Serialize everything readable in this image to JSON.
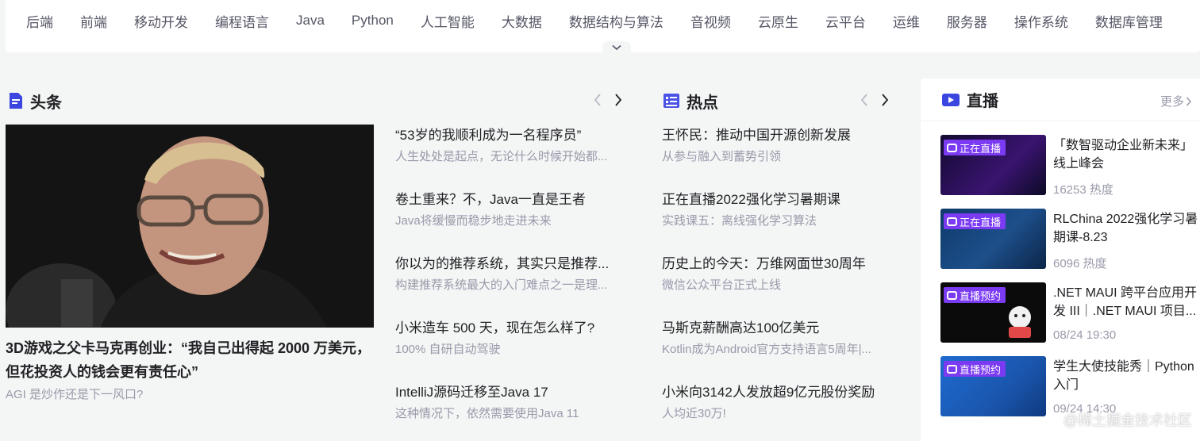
{
  "nav": {
    "categories": [
      "后端",
      "前端",
      "移动开发",
      "编程语言",
      "Java",
      "Python",
      "人工智能",
      "大数据",
      "数据结构与算法",
      "音视频",
      "云原生",
      "云平台",
      "运维",
      "服务器",
      "操作系统",
      "数据库管理"
    ]
  },
  "headlines": {
    "title": "头条",
    "hero": {
      "title": "3D游戏之父卡马克再创业：“我自己出得起 2000 万美元，但花投资人的钱会更有责任心”",
      "desc": "AGI 是炒作还是下一风口?"
    },
    "articles": [
      {
        "title": "“53岁的我顺利成为一名程序员”",
        "desc": "人生处处是起点，无论什么时候开始都..."
      },
      {
        "title": "卷土重来？不，Java一直是王者",
        "desc": "Java将缓慢而稳步地走进未来"
      },
      {
        "title": "你以为的推荐系统，其实只是推荐...",
        "desc": "构建推荐系统最大的入门难点之一是理..."
      },
      {
        "title": "小米造车 500 天，现在怎么样了?",
        "desc": "100% 自研自动驾驶"
      },
      {
        "title": "IntelliJ源码迁移至Java 17",
        "desc": "这种情况下，依然需要使用Java 11"
      }
    ]
  },
  "hot": {
    "title": "热点",
    "articles": [
      {
        "title": "王怀民：推动中国开源创新发展",
        "desc": "从参与融入到蓄势引领"
      },
      {
        "title": "正在直播2022强化学习暑期课",
        "desc": "实践课五：离线强化学习算法"
      },
      {
        "title": "历史上的今天：万维网面世30周年",
        "desc": "微信公众平台正式上线"
      },
      {
        "title": "马斯克薪酬高达100亿美元",
        "desc": "Kotlin成为Android官方支持语言5周年|..."
      },
      {
        "title": "小米向3142人发放超9亿元股份奖励",
        "desc": "人均近30万!"
      }
    ]
  },
  "live": {
    "title": "直播",
    "more": "更多",
    "items": [
      {
        "badge": "正在直播",
        "badge_color": "#7b3bf3",
        "title": "「数智驱动企业新未来」线上峰会",
        "meta": "16253 热度",
        "thumb_color": "#1a0f3a"
      },
      {
        "badge": "正在直播",
        "badge_color": "#7b3bf3",
        "title": "RLChina 2022强化学习暑期课-8.23",
        "meta": "6096 热度",
        "thumb_color": "#14305a"
      },
      {
        "badge": "直播预约",
        "badge_color": "#7b3bf3",
        "title": ".NET MAUI 跨平台应用开发 III｜.NET MAUI 项目...",
        "meta": "08/24 19:30",
        "thumb_color": "#0b0b0b"
      },
      {
        "badge": "直播预约",
        "badge_color": "#7b3bf3",
        "title": "学生大使技能秀｜Python 入门",
        "meta": "09/24 14:30",
        "thumb_color": "#1c5fb8"
      }
    ]
  },
  "watermark": "@稀土掘金技术社区",
  "colors": {
    "accent": "#5b6ee8",
    "hot_icon": "#4b53e6",
    "live_icon": "#3b46e0",
    "muted": "#999aaa"
  }
}
